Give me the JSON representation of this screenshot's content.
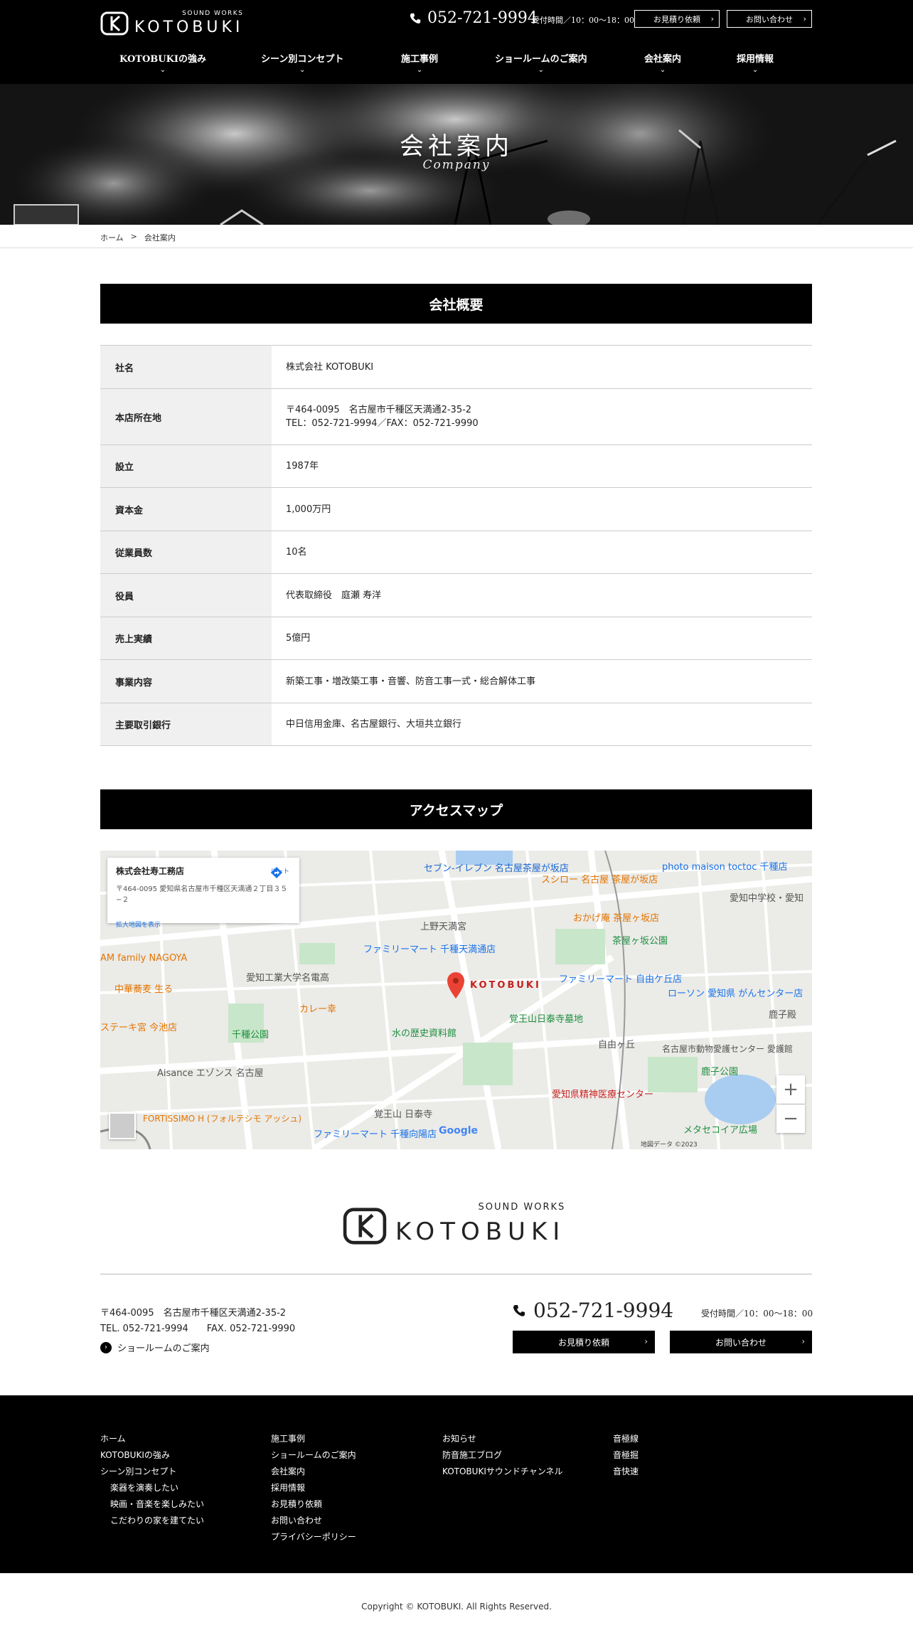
{
  "header": {
    "logo_small": "SOUND WORKS",
    "logo_big": "KOTOBUKI",
    "phone": "052-721-9994",
    "hours": "受付時間／10：00～18：00",
    "estimate_btn": "お見積り依頼",
    "contact_btn": "お問い合わせ"
  },
  "nav": [
    {
      "label": "KOTOBUKIの強み"
    },
    {
      "label": "シーン別コンセプト"
    },
    {
      "label": "施工事例"
    },
    {
      "label": "ショールームのご案内"
    },
    {
      "label": "会社案内"
    },
    {
      "label": "採用情報"
    }
  ],
  "hero": {
    "title": "会社案内",
    "subtitle": "Company"
  },
  "breadcrumb": {
    "home": "ホーム",
    "sep": ">",
    "current": "会社案内"
  },
  "overview": {
    "title": "会社概要",
    "rows": [
      {
        "label": "社名",
        "lines": [
          "株式会社 KOTOBUKI"
        ]
      },
      {
        "label": "本店所在地",
        "lines": [
          "〒464-0095　名古屋市千種区天満通2-35-2",
          "TEL：052-721-9994／FAX：052-721-9990"
        ]
      },
      {
        "label": "設立",
        "lines": [
          "1987年"
        ]
      },
      {
        "label": "資本金",
        "lines": [
          "1,000万円"
        ]
      },
      {
        "label": "従業員数",
        "lines": [
          "10名"
        ]
      },
      {
        "label": "役員",
        "lines": [
          "代表取締役　庭瀬 寿洋"
        ]
      },
      {
        "label": "売上実績",
        "lines": [
          "5億円"
        ]
      },
      {
        "label": "事業内容",
        "lines": [
          "新築工事・増改築工事・音響、防音工事一式・総合解体工事"
        ]
      },
      {
        "label": "主要取引銀行",
        "lines": [
          "中日信用金庫、名古屋銀行、大垣共立銀行"
        ]
      }
    ]
  },
  "access": {
    "title": "アクセスマップ",
    "card_name": "株式会社寿工務店",
    "card_addr": "〒464-0095 愛知県名古屋市千種区天満通２丁目３５−２",
    "card_link": "拡大地図を表示",
    "card_dir": "ルート",
    "marker_label": "KOTOBUKI",
    "zoom_in": "+",
    "zoom_out": "−",
    "google": "Google",
    "attribution": "地図データ ©2023",
    "labels": [
      "セブン-イレブン 名古屋茶屋が坂店",
      "スシロー 名古屋 茶屋が坂店",
      "photo maison toctoc 千種店",
      "愛知中学校・愛知",
      "上野天満宮",
      "おかげ庵 茶屋ヶ坂店",
      "茶屋ヶ坂公園",
      "ファミリーマート 千種天満通店",
      "愛知工業大学名電高",
      "ファミリーマート 自由ケ丘店",
      "ローソン 愛知県 がんセンター店",
      "中華蕎麦 生る",
      "カレー幸",
      "覚王山日泰寺墓地",
      "水の歴史資料館",
      "千種公園",
      "ステーキ宮 今池店",
      "自由ヶ丘",
      "名古屋市動物愛護センター 愛護館",
      "鹿子公園",
      "Aisance エゾンス 名古屋",
      "愛知県精神医療センター",
      "FORTISSIMO H (フォルテシモ アッシュ)",
      "覚王山 日泰寺",
      "ファミリーマート 千種向陽店",
      "メタセコイア広場",
      "AM family NAGOYA",
      "鹿子殿"
    ]
  },
  "footer": {
    "logo_small": "SOUND WORKS",
    "logo_big": "KOTOBUKI",
    "addr1": "〒464-0095　名古屋市千種区天満通2-35-2",
    "addr2": "TEL. 052-721-9994　　FAX. 052-721-9990",
    "showroom": "ショールームのご案内",
    "phone": "052-721-9994",
    "hours": "受付時間／10：00～18：00",
    "estimate_btn": "お見積り依頼",
    "contact_btn": "お問い合わせ",
    "col1": [
      "ホーム",
      "KOTOBUKIの強み",
      "シーン別コンセプト"
    ],
    "col1_sub": [
      "楽器を演奏したい",
      "映画・音楽を楽しみたい",
      "こだわりの家を建てたい"
    ],
    "col2": [
      "施工事例",
      "ショールームのご案内",
      "会社案内",
      "採用情報",
      "お見積り依頼",
      "お問い合わせ",
      "プライバシーポリシー"
    ],
    "col3": [
      "お知らせ",
      "防音施工ブログ",
      "KOTOBUKIサウンドチャンネル"
    ],
    "col4": [
      "音極線",
      "音極掘",
      "音快速"
    ],
    "copyright": "Copyright © KOTOBUKI. All Rights Reserved."
  },
  "colors": {
    "black": "#000000",
    "table_header_bg": "#f0f0f0",
    "map_marker": "#ea4335",
    "map_link": "#1a73e8"
  }
}
